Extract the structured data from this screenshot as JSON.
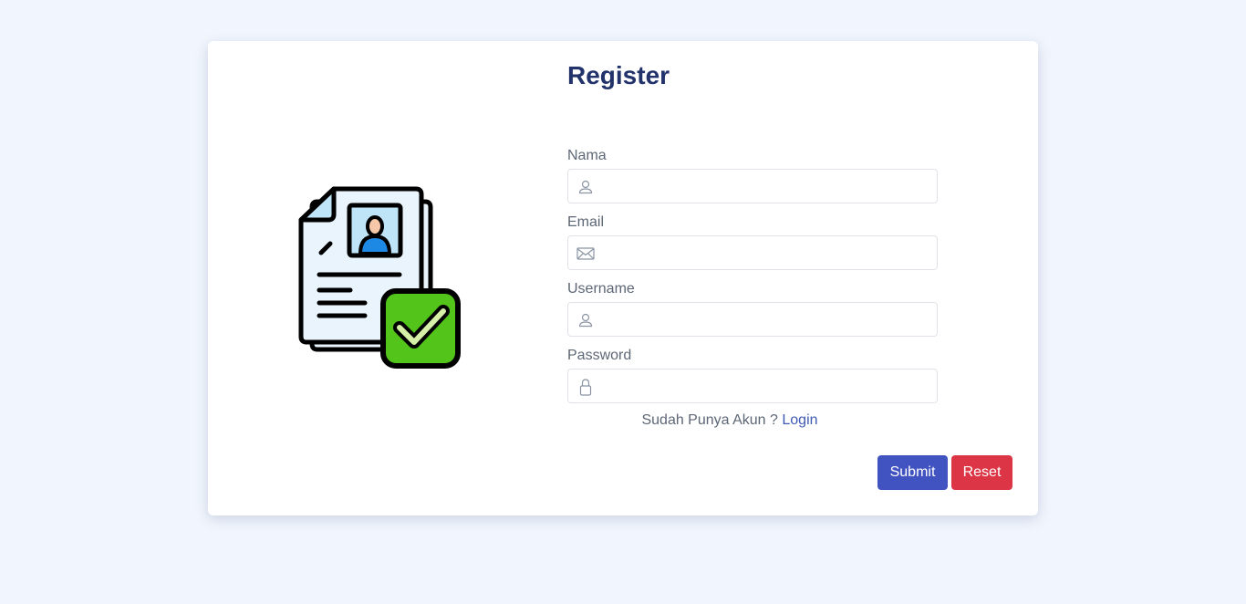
{
  "form": {
    "title": "Register",
    "fields": [
      {
        "label": "Nama",
        "icon": "user-icon",
        "value": "",
        "placeholder": ""
      },
      {
        "label": "Email",
        "icon": "envelope-icon",
        "value": "",
        "placeholder": ""
      },
      {
        "label": "Username",
        "icon": "user-icon",
        "value": "",
        "placeholder": ""
      },
      {
        "label": "Password",
        "icon": "lock-icon",
        "value": "",
        "placeholder": ""
      }
    ],
    "login_prompt": "Sudah Punya Akun ?",
    "login_link": "Login",
    "submit_label": "Submit",
    "reset_label": "Reset"
  },
  "illustration": {
    "icon": "document-approved-icon"
  },
  "colors": {
    "background": "#f1f5fd",
    "title": "#22336b",
    "submit": "#4153c0",
    "reset": "#dc3545",
    "link": "#3f5bb5",
    "check_green": "#52c41a"
  }
}
